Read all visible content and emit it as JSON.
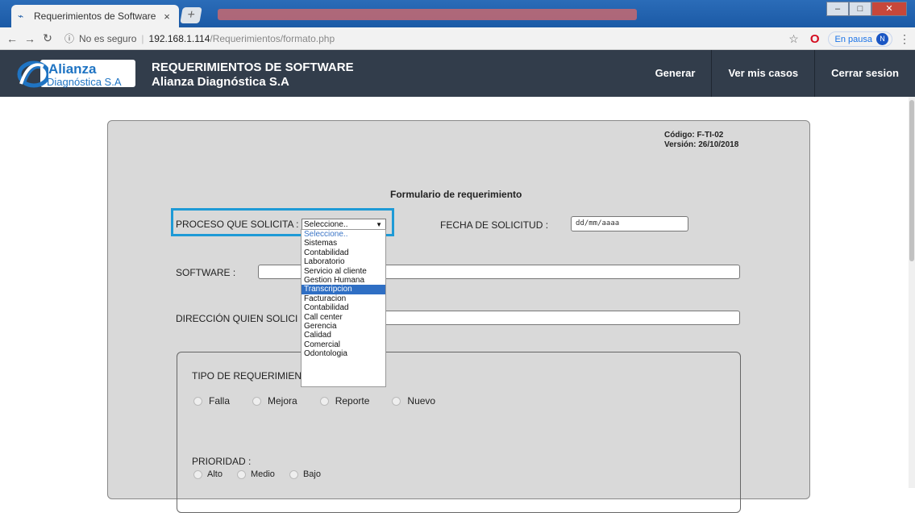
{
  "browser": {
    "tab_title": "Requerimientos de Software",
    "tab_close": "×",
    "new_tab": "+",
    "url_security": "No es seguro",
    "url_host": "192.168.1.114",
    "url_path": "/Requerimientos/formato.php",
    "profile_status": "En pausa",
    "profile_initial": "N"
  },
  "header": {
    "logo_name": "Alianza",
    "logo_sub": "Diagnóstica S.A",
    "title_line1": "REQUERIMIENTOS DE SOFTWARE",
    "title_line2": "Alianza Diagnóstica S.A",
    "nav": [
      "Generar",
      "Ver mis casos",
      "Cerrar sesion"
    ]
  },
  "form": {
    "code": "Código: F-TI-02",
    "version": "Versión: 26/10/2018",
    "title": "Formulario de requerimiento",
    "process_label": "PROCESO QUE SOLICITA :",
    "process_value": "Seleccione..",
    "date_label": "FECHA DE SOLICITUD :",
    "date_placeholder": "dd/mm/aaaa",
    "software_label": "SOFTWARE :",
    "address_label": "DIRECCIÓN QUIEN SOLICI",
    "type_label": "TIPO DE REQUERIMIEN",
    "types": [
      "Falla",
      "Mejora",
      "Reporte",
      "Nuevo"
    ],
    "priority_label": "PRIORIDAD :",
    "priorities": [
      "Alto",
      "Medio",
      "Bajo"
    ]
  },
  "dropdown": {
    "options": [
      "Seleccione..",
      "Sistemas",
      "Contabilidad",
      "Laboratorio",
      "Servicio al cliente",
      "Gestion Humana",
      "Transcripcion",
      "Facturacion",
      "Contabilidad",
      "Call center",
      "Gerencia",
      "Calidad",
      "Comercial",
      "Odontologia"
    ],
    "selected": "Transcripcion"
  }
}
